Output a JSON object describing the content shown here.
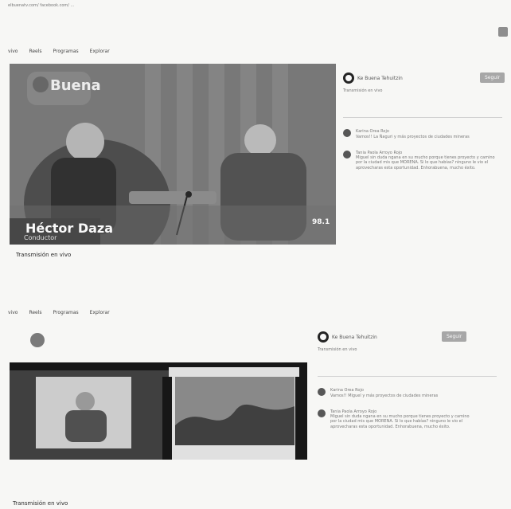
{
  "header": {
    "url": "elbuenatv.com/ facebook.com/ ..."
  },
  "nav": {
    "items": [
      "vivo",
      "Reels",
      "Programas",
      "Explorar"
    ]
  },
  "top": {
    "channel": "Ke Buena Tehuitzin",
    "follow_label": "Seguir",
    "status": "Transmisión en vivo",
    "lower_third_name": "Héctor Daza",
    "lower_third_role": "Conductor",
    "logo_text": "Buena",
    "watermark": "98.1",
    "comments": [
      {
        "author": "Karina Orea Rojo",
        "text": "Vamos!! La Ñaguri y más proyectos de ciudades mineras"
      },
      {
        "author": "Tania Paola Arroyo Rojo",
        "text": "Miguel sin duda ngana en su mucho porque tienes proyecto y camino por la ciudad mis que MORENA. Si lo que habías? ninguno le vio el aprovecharas esta oportunidad. Enhorabuena, mucho éxito."
      }
    ]
  },
  "bottom": {
    "channel": "Ke Buena Tehuitzin",
    "follow_label": "Seguir",
    "status": "Transmisión en vivo",
    "caption": "Transmisión en vivo",
    "comments": [
      {
        "author": "Karina Orea Rojo",
        "text": "Vamos!! Miguel y más proyectos de ciudades mineras"
      },
      {
        "author": "Tania Paola Arroyo Rojo",
        "text": "Miguel sin duda ngana en su mucho porque tienes proyecto y camino por la ciudad mis que MORENA. Si lo que habías? ninguno le vio el aprovecharas esta oportunidad. Enhorabuena, mucho éxito."
      }
    ]
  }
}
